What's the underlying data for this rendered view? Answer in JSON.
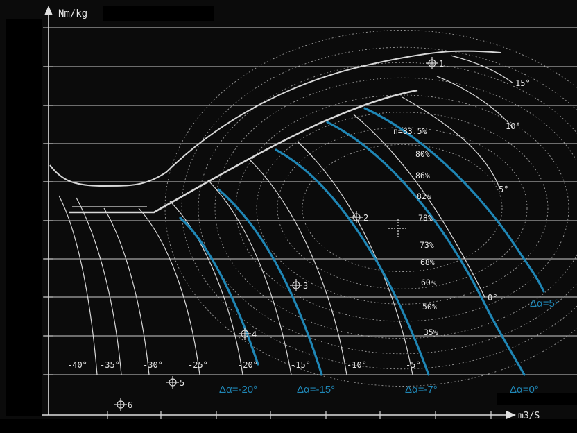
{
  "chart_data": {
    "type": "line",
    "title": "",
    "ylabel": "Nm/kg",
    "xlabel": "m3/S",
    "grid": true,
    "guide_vane_angles": [
      "-40°",
      "-35°",
      "-30°",
      "-25°",
      "-20°",
      "-15°",
      "-10°",
      "-5°",
      "0°",
      "5°",
      "10°",
      "15°"
    ],
    "efficiency_labels": [
      "n=83.5%",
      "80%",
      "86%",
      "82%",
      "78%",
      "73%",
      "68%",
      "60%",
      "50%",
      "35%"
    ],
    "operating_points": [
      "1",
      "2",
      "3",
      "4",
      "5",
      "6"
    ],
    "series": [
      {
        "name": "Δα=-20°",
        "color": "#1f86b5"
      },
      {
        "name": "Δα=-15°",
        "color": "#1f86b5"
      },
      {
        "name": "Δα=-7°",
        "color": "#1f86b5"
      },
      {
        "name": "Δα=0°",
        "color": "#1f86b5"
      },
      {
        "name": "Δα=5°",
        "color": "#1f86b5"
      }
    ]
  },
  "colors": {
    "background": "#0b0b0b",
    "lines": "#d8d8d8",
    "highlight": "#1f86b5"
  }
}
